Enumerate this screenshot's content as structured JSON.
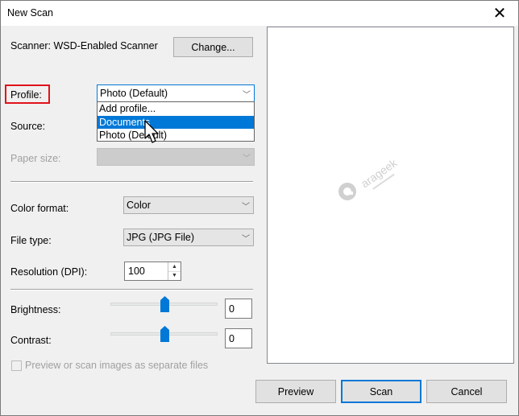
{
  "window": {
    "title": "New Scan"
  },
  "scanner": {
    "label": "Scanner: WSD-Enabled Scanner",
    "change_button": "Change..."
  },
  "profile": {
    "label": "Profile:",
    "selected": "Photo (Default)",
    "options": [
      "Add profile...",
      "Documents",
      "Photo (Default)"
    ],
    "highlighted_option": "Documents"
  },
  "source": {
    "label": "Source:"
  },
  "paper_size": {
    "label": "Paper size:",
    "value": ""
  },
  "color_format": {
    "label": "Color format:",
    "value": "Color"
  },
  "file_type": {
    "label": "File type:",
    "value": "JPG (JPG File)"
  },
  "resolution": {
    "label": "Resolution (DPI):",
    "value": "100"
  },
  "brightness": {
    "label": "Brightness:",
    "value": "0",
    "slider_fraction": 0.5
  },
  "contrast": {
    "label": "Contrast:",
    "value": "0",
    "slider_fraction": 0.5
  },
  "separate_files": {
    "label": "Preview or scan images as separate files",
    "checked": false
  },
  "buttons": {
    "preview": "Preview",
    "scan": "Scan",
    "cancel": "Cancel"
  },
  "watermark": {
    "text": "arageek"
  },
  "colors": {
    "accent": "#0078d7",
    "annotation_box": "#e2121a"
  }
}
